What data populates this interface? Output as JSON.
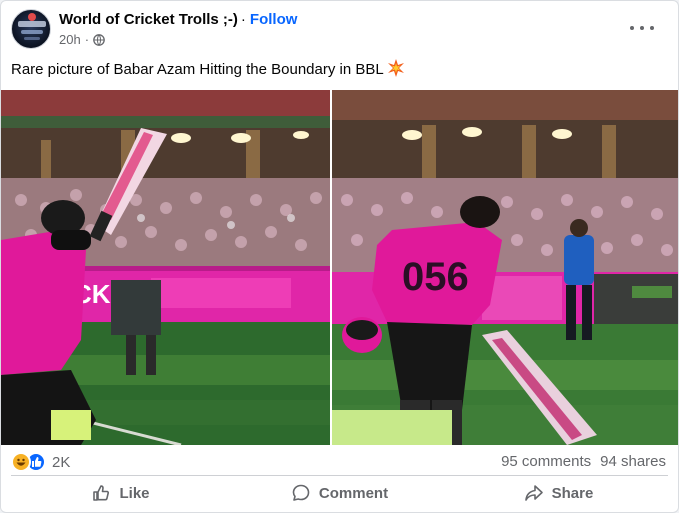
{
  "post": {
    "page_name": "World of Cricket Trolls ;-)",
    "follow_label": "Follow",
    "time": "20h",
    "audience_icon": "globe-icon",
    "more_icon": "ellipsis-icon",
    "caption": "Rare picture of Babar Azam Hitting the Boundary in BBL",
    "caption_emoji": "collision-emoji",
    "media": {
      "panel_count": 2,
      "jersey_text": "056",
      "board_text": "CK"
    },
    "reactions": {
      "icons": [
        "haha-icon",
        "like-icon"
      ],
      "count": "2K"
    },
    "comments": "95 comments",
    "shares": "94 shares",
    "actions": [
      {
        "label": "Like",
        "icon": "thumbs-up-icon"
      },
      {
        "label": "Comment",
        "icon": "comment-icon"
      },
      {
        "label": "Share",
        "icon": "share-icon"
      }
    ]
  },
  "colors": {
    "brand_blue": "#0866ff",
    "secondary_text": "#65676b",
    "sixers_magenta": "#e5179b"
  }
}
